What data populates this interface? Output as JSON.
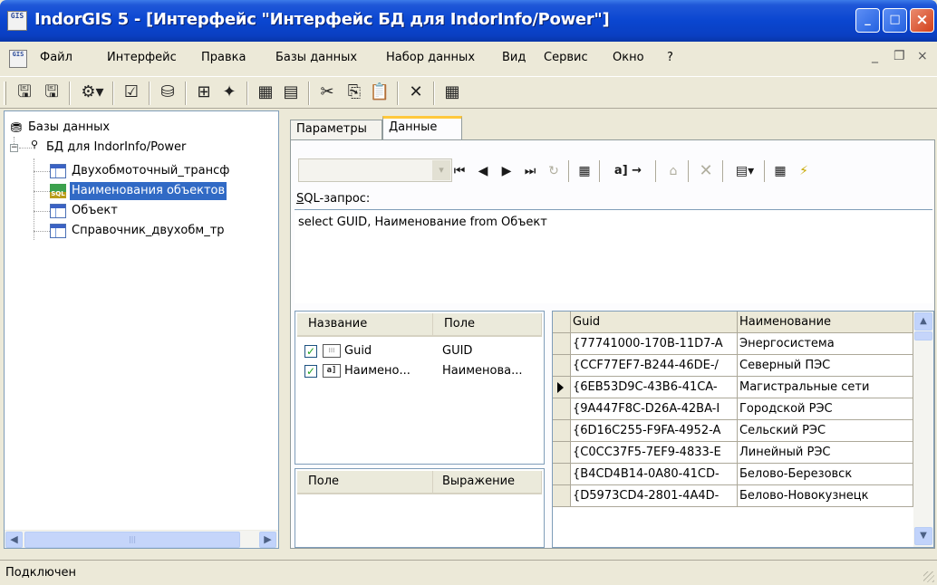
{
  "window": {
    "title": "IndorGIS 5 - [Интерфейс \"Интерфейс БД для IndorInfo/Power\"]",
    "app_icon_text": "GIS",
    "min": "_",
    "max": "□",
    "close": "×"
  },
  "menu": {
    "items": [
      "Файл",
      "Интерфейс",
      "Правка",
      "Базы данных",
      "Набор данных",
      "Вид",
      "Сервис",
      "Окно",
      "?"
    ],
    "mdi_min": "_",
    "mdi_restore": "❐",
    "mdi_close": "×"
  },
  "tree": {
    "root_label": "Базы данных",
    "db_label": "БД для IndorInfo/Power",
    "db_icon_text": "ADO",
    "items": [
      {
        "label": "Двухобмоточный_трансф",
        "icon": "table-icon"
      },
      {
        "label": "Наименования объектов",
        "icon": "sql-icon"
      },
      {
        "label": "Объект",
        "icon": "table-icon"
      },
      {
        "label": "Справочник_двухобм_тр",
        "icon": "table-icon"
      }
    ],
    "selected_index": 1,
    "sql_icon_text": "SQL"
  },
  "tabs": {
    "params": "Параметры",
    "data": "Данные"
  },
  "sql": {
    "label": "SQL-запрос:",
    "query": "select GUID, Наименование from Объект"
  },
  "fields_pane": {
    "col_name": "Название",
    "col_field": "Поле",
    "rows": [
      {
        "name": "Guid",
        "field": "GUID",
        "type_icon": "⁝⁝⁝"
      },
      {
        "name": "Наимено...",
        "field": "Наименова...",
        "type_icon": "a]"
      }
    ]
  },
  "expr_pane": {
    "col_field": "Поле",
    "col_expr": "Выражение"
  },
  "grid": {
    "columns": [
      "Guid",
      "Наименование"
    ],
    "current_row": 2,
    "rows": [
      [
        "{77741000-170B-11D7-A",
        "Энергосистема"
      ],
      [
        "{CCF77EF7-B244-46DE-/",
        "Северный ПЭС"
      ],
      [
        "{6EB53D9C-43B6-41CA-",
        "Магистральные сети"
      ],
      [
        "{9A447F8C-D26A-42BA-I",
        "Городской РЭС"
      ],
      [
        "{6D16C255-F9FA-4952-A",
        "Сельский РЭС"
      ],
      [
        "{C0CC37F5-7EF9-4833-E",
        "Линейный РЭС"
      ],
      [
        "{B4CD4B14-0A80-41CD-",
        "Белово-Березовск"
      ],
      [
        "{D5973CD4-2801-4A4D-",
        "Белово-Новокузнецк"
      ]
    ]
  },
  "status": {
    "text": "Подключен"
  },
  "colors": {
    "title_blue": "#0a46d0",
    "selection": "#316ac5",
    "tab_accent": "#ffc83c"
  }
}
